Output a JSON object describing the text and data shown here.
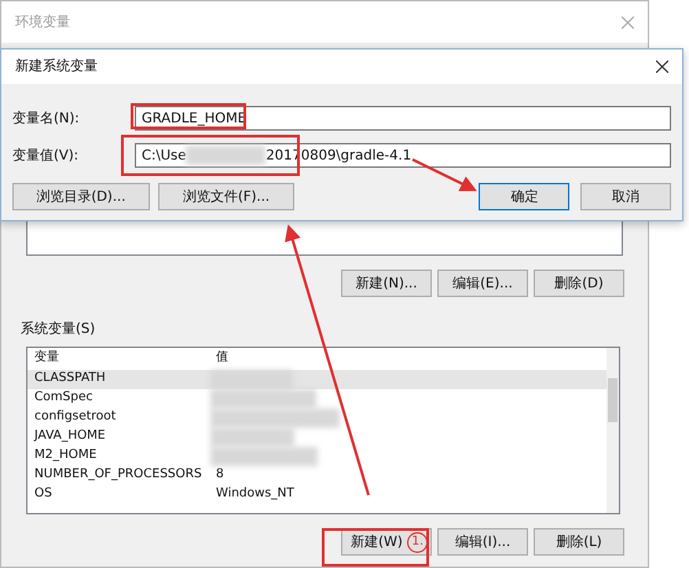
{
  "back_window": {
    "title": "环境变量",
    "user_buttons": [
      "新建(N)...",
      "编辑(E)...",
      "删除(D)"
    ],
    "system_group": "系统变量(S)",
    "columns": [
      "变量",
      "值"
    ],
    "rows": [
      {
        "name": "CLASSPATH",
        "value": null,
        "redacted": true,
        "selected": true
      },
      {
        "name": "ComSpec",
        "value": null,
        "redacted": true,
        "selected": false
      },
      {
        "name": "configsetroot",
        "value": null,
        "redacted": true,
        "selected": false
      },
      {
        "name": "JAVA_HOME",
        "value": null,
        "redacted": true,
        "selected": false
      },
      {
        "name": "M2_HOME",
        "value": null,
        "redacted": true,
        "selected": false
      },
      {
        "name": "NUMBER_OF_PROCESSORS",
        "value": "8",
        "redacted": false,
        "selected": false
      },
      {
        "name": "OS",
        "value": "Windows_NT",
        "redacted": false,
        "selected": false
      }
    ],
    "system_buttons": [
      "新建(W)",
      "编辑(I)...",
      "删除(L)"
    ]
  },
  "dialog": {
    "title": "新建系统变量",
    "name_label": "变量名(N):",
    "name_value": "GRADLE_HOME",
    "value_label": "变量值(V):",
    "value_start": "C:\\Use",
    "value_end": "20170809\\gradle-4.1",
    "buttons": [
      {
        "label": "浏览目录(D)...",
        "default": false
      },
      {
        "label": "浏览文件(F)...",
        "default": false
      },
      {
        "label": "确定",
        "default": true
      },
      {
        "label": "取消",
        "default": false
      }
    ]
  },
  "annotation": {
    "step": "1."
  }
}
